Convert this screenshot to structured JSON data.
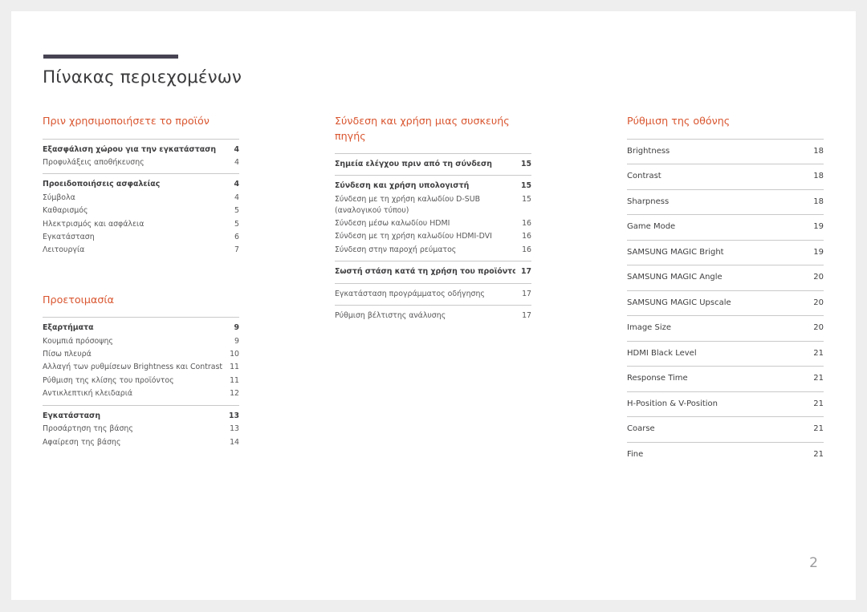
{
  "document": {
    "title": "Πίνακας περιεχομένων",
    "page_number": "2",
    "accent_color": "#474353",
    "heading_color": "#d9552f"
  },
  "columns": [
    {
      "name": "column-1",
      "sections": [
        {
          "heading": "Πριν χρησιμοποιήσετε το προϊόν",
          "groups": [
            {
              "rows": [
                {
                  "label": "Εξασφάλιση χώρου για την εγκατάσταση",
                  "page": "4",
                  "lead": true
                },
                {
                  "label": "Προφυλάξεις αποθήκευσης",
                  "page": "4",
                  "lead": false
                }
              ]
            },
            {
              "rows": [
                {
                  "label": "Προειδοποιήσεις ασφαλείας",
                  "page": "4",
                  "lead": true
                },
                {
                  "label": "Σύμβολα",
                  "page": "4",
                  "lead": false
                },
                {
                  "label": "Καθαρισμός",
                  "page": "5",
                  "lead": false
                },
                {
                  "label": "Ηλεκτρισμός και ασφάλεια",
                  "page": "5",
                  "lead": false
                },
                {
                  "label": "Εγκατάσταση",
                  "page": "6",
                  "lead": false
                },
                {
                  "label": "Λειτουργία",
                  "page": "7",
                  "lead": false
                }
              ]
            }
          ]
        },
        {
          "heading": "Προετοιμασία",
          "groups": [
            {
              "rows": [
                {
                  "label": "Εξαρτήματα",
                  "page": "9",
                  "lead": true
                },
                {
                  "label": "Κουμπιά πρόσοψης",
                  "page": "9",
                  "lead": false
                },
                {
                  "label": "Πίσω πλευρά",
                  "page": "10",
                  "lead": false
                },
                {
                  "label": "Αλλαγή των ρυθμίσεων Brightness και Contrast",
                  "page": "11",
                  "lead": false
                },
                {
                  "label": "Ρύθμιση της κλίσης του προϊόντος",
                  "page": "11",
                  "lead": false
                },
                {
                  "label": "Αντικλεπτική κλειδαριά",
                  "page": "12",
                  "lead": false
                }
              ]
            },
            {
              "rows": [
                {
                  "label": "Εγκατάσταση",
                  "page": "13",
                  "lead": true
                },
                {
                  "label": "Προσάρτηση της βάσης",
                  "page": "13",
                  "lead": false
                },
                {
                  "label": "Αφαίρεση της βάσης",
                  "page": "14",
                  "lead": false
                }
              ]
            }
          ]
        }
      ]
    },
    {
      "name": "column-2",
      "sections": [
        {
          "heading": "Σύνδεση και χρήση μιας συσκευής πηγής",
          "groups": [
            {
              "rows": [
                {
                  "label": "Σημεία ελέγχου πριν από τη σύνδεση",
                  "page": "15",
                  "lead": true
                }
              ]
            },
            {
              "rows": [
                {
                  "label": "Σύνδεση και χρήση υπολογιστή",
                  "page": "15",
                  "lead": true
                },
                {
                  "label": "Σύνδεση με τη χρήση καλωδίου D-SUB (αναλογικού τύπου)",
                  "page": "15",
                  "lead": false,
                  "wrap": true
                },
                {
                  "label": "Σύνδεση μέσω καλωδίου HDMI",
                  "page": "16",
                  "lead": false
                },
                {
                  "label": "Σύνδεση με τη χρήση καλωδίου HDMI-DVI",
                  "page": "16",
                  "lead": false
                },
                {
                  "label": "Σύνδεση στην παροχή ρεύματος",
                  "page": "16",
                  "lead": false
                }
              ]
            },
            {
              "rows": [
                {
                  "label": "Σωστή στάση κατά τη χρήση του προϊόντος",
                  "page": "17",
                  "lead": true
                }
              ]
            },
            {
              "rows": [
                {
                  "label": "Εγκατάσταση προγράμματος οδήγησης",
                  "page": "17",
                  "lead": false
                }
              ]
            },
            {
              "rows": [
                {
                  "label": "Ρύθμιση βέλτιστης ανάλυσης",
                  "page": "17",
                  "lead": false
                }
              ]
            }
          ]
        }
      ]
    },
    {
      "name": "column-3",
      "ruled": true,
      "sections": [
        {
          "heading": "Ρύθμιση της οθόνης",
          "groups": [
            {
              "rows": [
                {
                  "label": "Brightness",
                  "page": "18",
                  "lead": false
                }
              ]
            },
            {
              "rows": [
                {
                  "label": "Contrast",
                  "page": "18",
                  "lead": false
                }
              ]
            },
            {
              "rows": [
                {
                  "label": "Sharpness",
                  "page": "18",
                  "lead": false
                }
              ]
            },
            {
              "rows": [
                {
                  "label": "Game Mode",
                  "page": "19",
                  "lead": false
                }
              ]
            },
            {
              "rows": [
                {
                  "label": "SAMSUNG MAGIC Bright",
                  "page": "19",
                  "lead": false
                }
              ]
            },
            {
              "rows": [
                {
                  "label": "SAMSUNG MAGIC Angle",
                  "page": "20",
                  "lead": false
                }
              ]
            },
            {
              "rows": [
                {
                  "label": "SAMSUNG MAGIC Upscale",
                  "page": "20",
                  "lead": false
                }
              ]
            },
            {
              "rows": [
                {
                  "label": "Image Size",
                  "page": "20",
                  "lead": false
                }
              ]
            },
            {
              "rows": [
                {
                  "label": "HDMI Black Level",
                  "page": "21",
                  "lead": false
                }
              ]
            },
            {
              "rows": [
                {
                  "label": "Response Time",
                  "page": "21",
                  "lead": false
                }
              ]
            },
            {
              "rows": [
                {
                  "label": "H-Position & V-Position",
                  "page": "21",
                  "lead": false
                }
              ]
            },
            {
              "rows": [
                {
                  "label": "Coarse",
                  "page": "21",
                  "lead": false
                }
              ]
            },
            {
              "rows": [
                {
                  "label": "Fine",
                  "page": "21",
                  "lead": false
                }
              ]
            }
          ]
        }
      ]
    }
  ]
}
